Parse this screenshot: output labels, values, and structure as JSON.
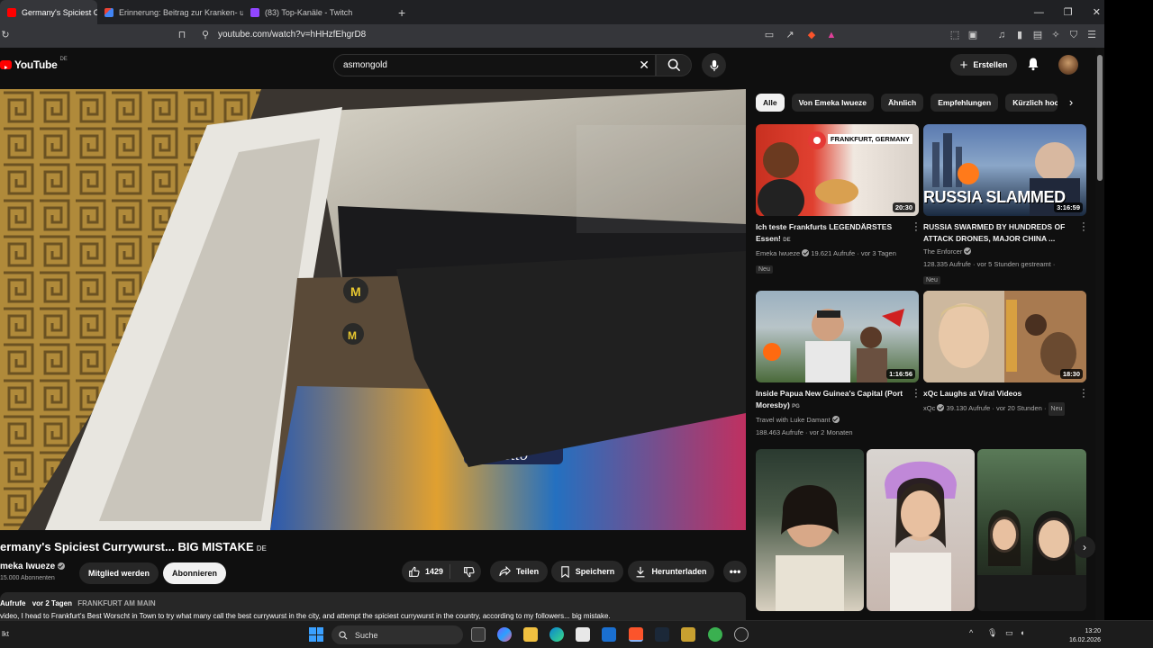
{
  "browser": {
    "tabs": [
      {
        "label": "Germany's Spiciest Curry",
        "active": true,
        "favicon": "youtube-icon"
      },
      {
        "label": "Erinnerung: Beitrag zur Kranken- und",
        "active": false,
        "favicon": "gmail-icon"
      },
      {
        "label": "(83) Top-Kanäle - Twitch",
        "active": false,
        "favicon": "twitch-icon"
      }
    ],
    "url": "youtube.com/watch?v=hHHzfEhgrD8"
  },
  "youtube": {
    "logo_text": "YouTube",
    "logo_region": "DE",
    "search_value": "asmongold",
    "create_label": "Erstellen"
  },
  "video": {
    "title": "ermany's Spiciest Currywurst... BIG MISTAKE",
    "title_badge": "DE",
    "channel": "meka Iwueze",
    "subscribers": "15.000 Abonnenten",
    "join_label": "Mitglied werden",
    "subscribe_label": "Abonnieren",
    "likes": "1429",
    "share_label": "Teilen",
    "save_label": "Speichern",
    "download_label": "Herunterladen",
    "views_label": "Aufrufe",
    "age": "vor 2 Tagen",
    "location": "FRANKFURT AM MAIN",
    "description_line": "video, I head to Frankfurt's Best Worscht in Town to try what many call the best currywurst in the city, and attempt the spiciest currywurst in the country, according to my followers... big mistake."
  },
  "chips": [
    "Alle",
    "Von Emeka Iwueze",
    "Ähnlich",
    "Empfehlungen",
    "Kürzlich hoc"
  ],
  "recommendations": [
    {
      "title": "Ich teste Frankfurts LEGENDÄRSTES Essen!",
      "badge": "DE",
      "channel": "Emeka Iwueze",
      "meta": "19.621 Aufrufe · vor 3 Tagen",
      "duration": "20:30",
      "new": "Neu",
      "thumb_text": "FRANKFURT, GERMANY"
    },
    {
      "title": "RUSSIA SWARMED BY HUNDREDS OF ATTACK DRONES, MAJOR CHINA ...",
      "channel": "The Enforcer",
      "meta": "128.335 Aufrufe · vor 5 Stunden gestreamt ·",
      "duration": "3:16:59",
      "new": "Neu",
      "thumb_text": "RUSSIA SLAMMED"
    },
    {
      "title": "Inside Papua New Guinea's Capital (Port Moresby)",
      "badge": "PG",
      "channel": "Travel with Luke Damant",
      "meta": "188.463 Aufrufe · vor 2 Monaten",
      "duration": "1:16:56"
    },
    {
      "title": "xQc Laughs at Viral Videos",
      "channel": "xQc",
      "meta": "39.130 Aufrufe · vor 20 Stunden ·",
      "duration": "18:30",
      "new": "Neu"
    }
  ],
  "taskbar": {
    "left_text": "lkt",
    "search_label": "Suche",
    "time": "13:20",
    "date": "16.02.2026"
  }
}
